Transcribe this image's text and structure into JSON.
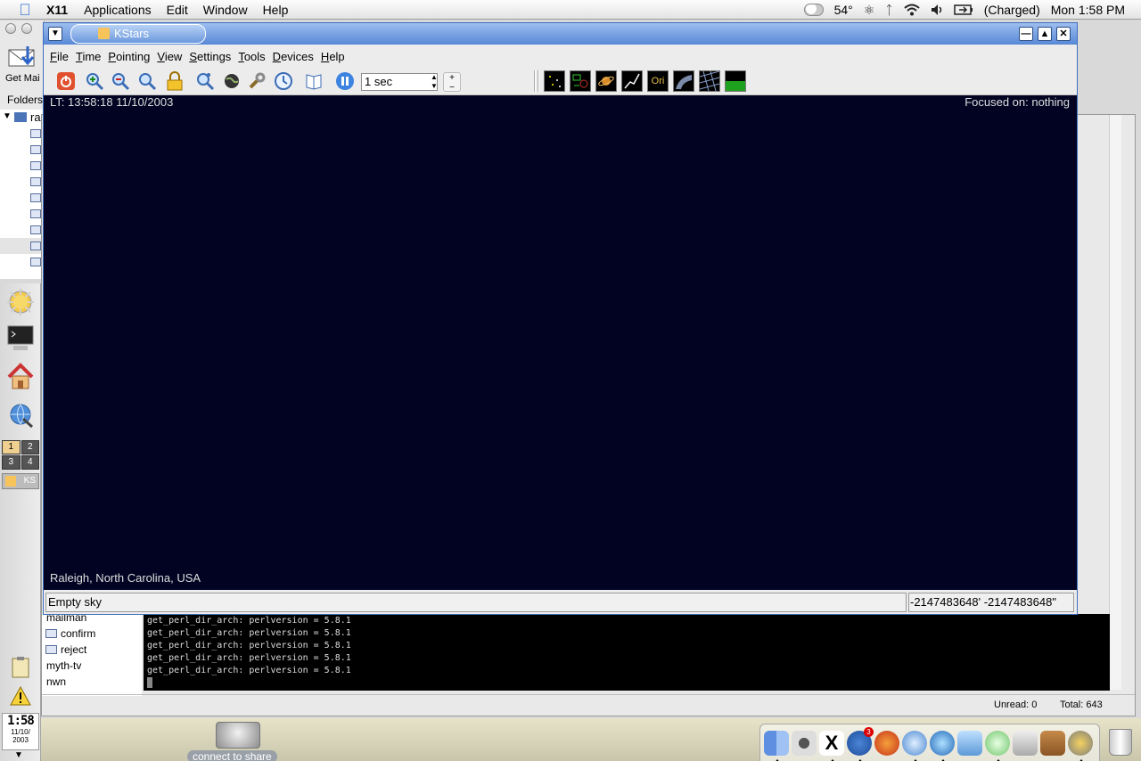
{
  "menubar": {
    "app_name": "X11",
    "items": [
      "Applications",
      "Edit",
      "Window",
      "Help"
    ],
    "temperature": "54°",
    "battery": "(Charged)",
    "clock": "Mon 1:58 PM"
  },
  "mail": {
    "get_mail_label": "Get Mai",
    "folders_label": "Folders",
    "tree_root": "ra",
    "folders": [
      "confirm",
      "reject",
      "myth-tv",
      "nwn"
    ],
    "partial_folder": "mailman",
    "unread": "Unread: 0",
    "total": "Total: 643"
  },
  "terminal": {
    "lines": [
      "get_perl_dir_arch: perlversion = 5.8.1",
      "get_perl_dir_arch: perlversion = 5.8.1",
      "get_perl_dir_arch: perlversion = 5.8.1",
      "get_perl_dir_arch: perlversion = 5.8.1",
      "get_perl_dir_arch: perlversion = 5.8.1"
    ]
  },
  "kicker": {
    "pager": [
      "1",
      "2",
      "3",
      "4"
    ],
    "task_label": "KS",
    "clock_time": "1:58",
    "clock_date_1": "11/10/",
    "clock_date_2": "2003"
  },
  "desktop": {
    "share_label": "connect to share",
    "dock_badge": "3"
  },
  "kstars": {
    "title": "KStars",
    "menu": [
      {
        "u": "F",
        "rest": "ile"
      },
      {
        "u": "T",
        "rest": "ime"
      },
      {
        "u": "P",
        "rest": "ointing"
      },
      {
        "u": "V",
        "rest": "iew"
      },
      {
        "u": "S",
        "rest": "ettings"
      },
      {
        "u": "T",
        "rest": "ools"
      },
      {
        "u": "D",
        "rest": "evices"
      },
      {
        "u": "H",
        "rest": "elp"
      }
    ],
    "timestep": "1 sec",
    "sky_toggle_ori": "Ori",
    "lt": "LT: 13:58:18   11/10/2003",
    "focused": "Focused on: nothing",
    "location": "Raleigh, North Carolina,  USA",
    "status": "Empty sky",
    "coords": "-2147483648' -2147483648\"",
    "colors": {
      "sky": "#020322",
      "titlebar": "#5888d6"
    }
  }
}
